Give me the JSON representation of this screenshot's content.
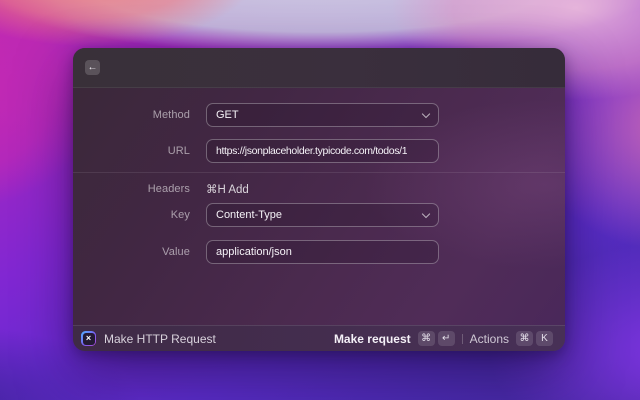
{
  "window": {
    "titlebar": {
      "back_icon": "←"
    },
    "form": {
      "method": {
        "label": "Method",
        "value": "GET"
      },
      "url": {
        "label": "URL",
        "value": "https://jsonplaceholder.typicode.com/todos/1"
      },
      "headers": {
        "label": "Headers",
        "action": "⌘H Add"
      },
      "key": {
        "label": "Key",
        "value": "Content-Type"
      },
      "value": {
        "label": "Value",
        "value": "application/json"
      }
    },
    "footer": {
      "extension_glyph": "×",
      "title": "Make HTTP Request",
      "primary_label": "Make request",
      "primary_keys": {
        "mod": "⌘",
        "enter": "↵"
      },
      "actions_label": "Actions",
      "actions_keys": {
        "mod": "⌘",
        "k": "K"
      }
    }
  },
  "colors": {
    "wallpaper_magenta": "#b82aae",
    "wallpaper_violet": "#6b2ad2",
    "window_tint": "#452a4a",
    "input_border": "rgba(255,255,255,0.3)",
    "keycap_bg": "rgba(255,255,255,0.13)"
  }
}
